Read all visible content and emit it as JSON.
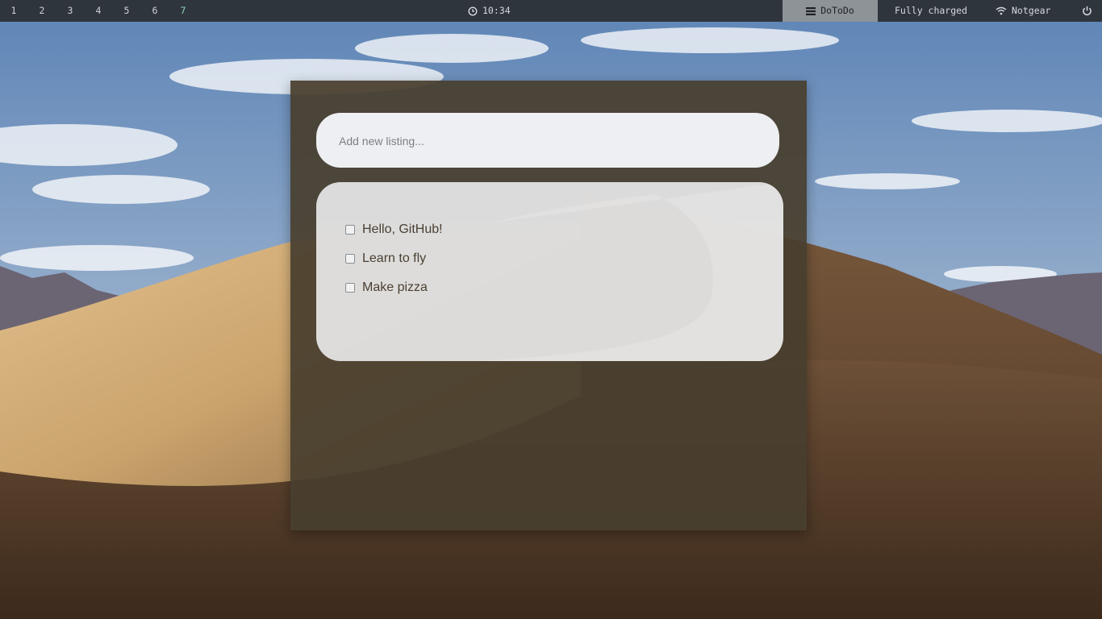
{
  "topbar": {
    "workspaces": [
      "1",
      "2",
      "3",
      "4",
      "5",
      "6",
      "7"
    ],
    "active_workspace": "7",
    "clock": {
      "icon": "clock-icon",
      "time": "10:34"
    },
    "window": {
      "icon": "window-list-icon",
      "title": "DoToDo"
    },
    "battery": "Fully charged",
    "wifi": {
      "icon": "wifi-icon",
      "ssid": "Notgear"
    },
    "power": {
      "icon": "power-icon"
    }
  },
  "app": {
    "input": {
      "placeholder": "Add new listing...",
      "value": ""
    },
    "todos": [
      {
        "label": "Hello, GitHub!",
        "checked": false
      },
      {
        "label": "Learn to fly",
        "checked": false
      },
      {
        "label": "Make pizza",
        "checked": false
      }
    ]
  },
  "colors": {
    "topbar_bg": "#2f353d",
    "active_workspace": "#8fd3b0",
    "window_title_bg": "#8e9398",
    "app_bg": "#483e2e"
  }
}
